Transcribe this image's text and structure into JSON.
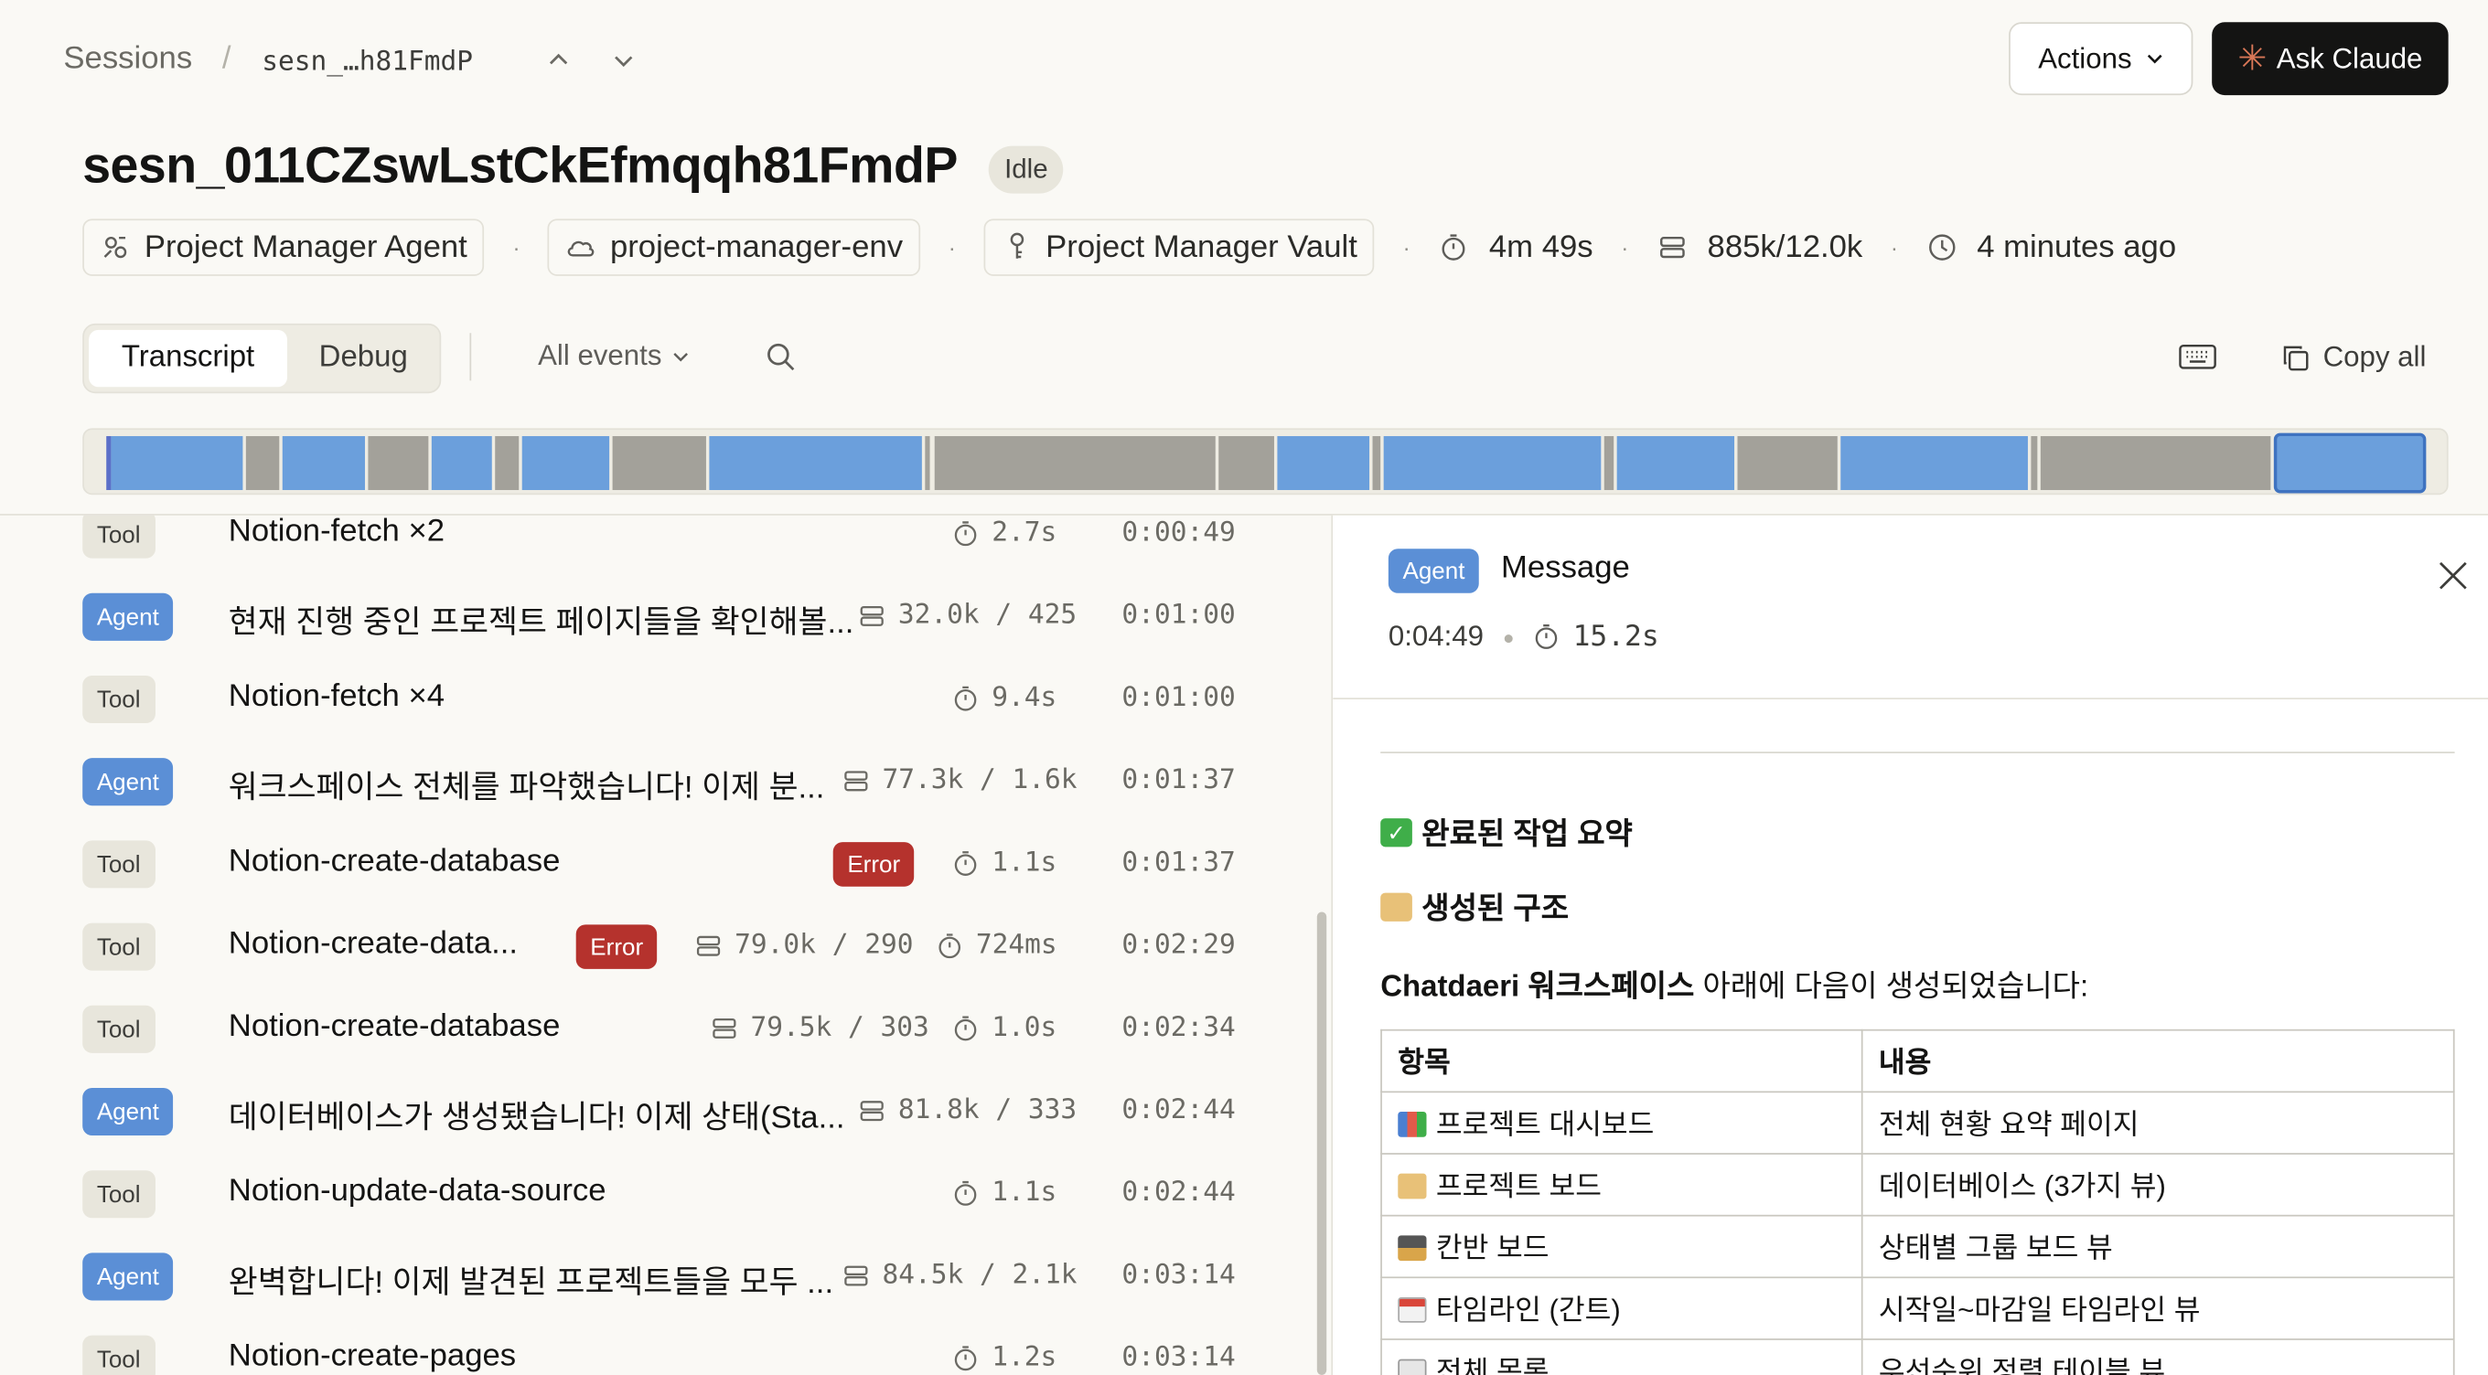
{
  "breadcrumb": {
    "root": "Sessions",
    "sep": "/",
    "current": "sesn_…h81FmdP"
  },
  "header": {
    "actions_label": "Actions",
    "ask_label": "Ask Claude",
    "title": "sesn_011CZswLstCkEfmqqh81FmdP",
    "status": "Idle"
  },
  "meta": {
    "agent": "Project Manager Agent",
    "env": "project-manager-env",
    "vault": "Project Manager Vault",
    "duration": "4m 49s",
    "tokens": "885k/12.0k",
    "ago": "4 minutes ago"
  },
  "toolbar": {
    "tab_transcript": "Transcript",
    "tab_debug": "Debug",
    "filter": "All events",
    "copy_all": "Copy all"
  },
  "colors": {
    "agent": "#5b8fd6",
    "tool": "#e8e6dc",
    "error": "#b5322d",
    "timeline_blue": "#6b9fdc",
    "timeline_gray": "#a3a19a"
  },
  "events": [
    {
      "type": "Tool",
      "title": "Notion-fetch ×2",
      "tokens": "",
      "duration": "2.7s",
      "time": "0:00:49",
      "error": ""
    },
    {
      "type": "Agent",
      "title": "현재 진행 중인 프로젝트 페이지들을 확인해볼...",
      "tokens": "32.0k / 425",
      "duration": "",
      "time": "0:01:00",
      "error": ""
    },
    {
      "type": "Tool",
      "title": "Notion-fetch ×4",
      "tokens": "",
      "duration": "9.4s",
      "time": "0:01:00",
      "error": ""
    },
    {
      "type": "Agent",
      "title": "워크스페이스 전체를 파악했습니다! 이제 분...",
      "tokens": "77.3k / 1.6k",
      "duration": "",
      "time": "0:01:37",
      "error": ""
    },
    {
      "type": "Tool",
      "title": "Notion-create-database",
      "tokens": "",
      "duration": "1.1s",
      "time": "0:01:37",
      "error": "Error"
    },
    {
      "type": "Tool",
      "title": "Notion-create-data...",
      "tokens": "79.0k / 290",
      "duration": "724ms",
      "time": "0:02:29",
      "error": "Error"
    },
    {
      "type": "Tool",
      "title": "Notion-create-database",
      "tokens": "79.5k / 303",
      "duration": "1.0s",
      "time": "0:02:34",
      "error": ""
    },
    {
      "type": "Agent",
      "title": "데이터베이스가 생성됐습니다! 이제 상태(Sta...",
      "tokens": "81.8k / 333",
      "duration": "",
      "time": "0:02:44",
      "error": ""
    },
    {
      "type": "Tool",
      "title": "Notion-update-data-source",
      "tokens": "",
      "duration": "1.1s",
      "time": "0:02:44",
      "error": ""
    },
    {
      "type": "Agent",
      "title": "완벽합니다! 이제 발견된 프로젝트들을 모두 ...",
      "tokens": "84.5k / 2.1k",
      "duration": "",
      "time": "0:03:14",
      "error": ""
    },
    {
      "type": "Tool",
      "title": "Notion-create-pages",
      "tokens": "",
      "duration": "1.2s",
      "time": "0:03:14",
      "error": ""
    }
  ],
  "detail": {
    "tag": "Agent",
    "title": "Message",
    "time": "0:04:49",
    "duration": "15.2s",
    "heading1": "완료된 작업 요약",
    "heading2": "생성된 구조",
    "para_bold": "Chatdaeri 워크스페이스",
    "para_rest": " 아래에 다음이 생성되었습니다:",
    "table_headers": [
      "항목",
      "내용"
    ],
    "table_rows": [
      [
        "프로젝트 대시보드",
        "전체 현황 요약 페이지"
      ],
      [
        "프로젝트 보드",
        "데이터베이스 (3가지 뷰)"
      ],
      [
        "칸반 보드",
        "상태별 그룹 보드 뷰"
      ],
      [
        "타임라인 (간트)",
        "시작일~마감일 타임라인 뷰"
      ],
      [
        "전체 목록",
        "우선순위 정렬 테이블 뷰"
      ]
    ]
  }
}
